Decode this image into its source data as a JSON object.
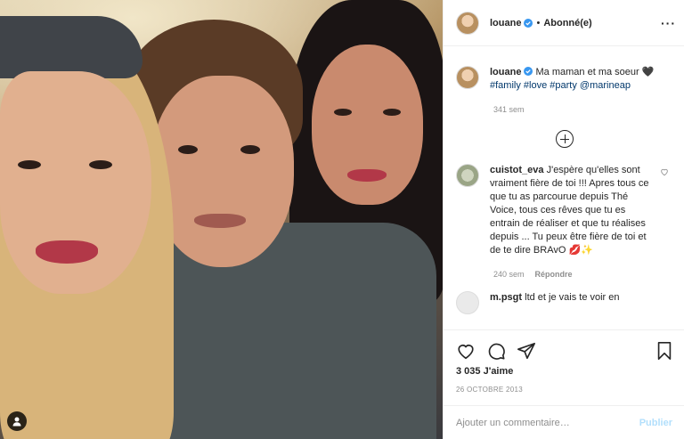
{
  "post": {
    "username": "louane",
    "follow_status": "Abonné(e)",
    "separator": "•",
    "more_label": "···"
  },
  "caption": {
    "username": "louane",
    "text": "Ma maman et ma soeur 🖤",
    "tags": [
      "#family",
      "#love",
      "#party",
      "@marineap"
    ],
    "time": "341 sem"
  },
  "comments": [
    {
      "username": "cuistot_eva",
      "text": "J'espère qu'elles sont vraiment fière de toi !!! Apres tous ce que tu as parcourue depuis Thé Voice, tous ces rêves que tu es entrain de réaliser et que tu réalises depuis ... Tu peux être fière de toi et de te dire BRAvO 💋✨",
      "time": "240 sem",
      "reply": "Répondre"
    },
    {
      "username": "m.psgt",
      "text": "ltd et je vais te voir en"
    }
  ],
  "actions": {
    "likes": "3 035 J'aime",
    "date": "26 OCTOBRE 2013"
  },
  "comment_box": {
    "placeholder": "Ajouter un commentaire…",
    "publish": "Publier"
  },
  "icons": [
    "user-tag-icon",
    "heart-icon",
    "comment-icon",
    "share-icon",
    "bookmark-icon",
    "verified-icon",
    "plus-circle-icon",
    "ellipsis-icon"
  ],
  "colors": {
    "link": "#00376b",
    "verified": "#3897f0",
    "publish_disabled": "#b2dffc",
    "meta": "#8e8e8e"
  }
}
